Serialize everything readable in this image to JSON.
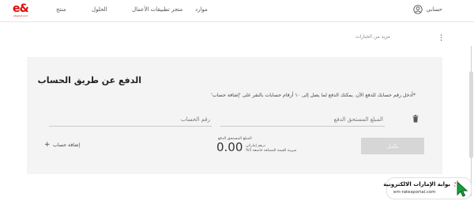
{
  "nav": {
    "logo_mark": "e&",
    "logo_sub": "etisalat and",
    "links": [
      {
        "label": "منتج"
      },
      {
        "label": "الحلول"
      },
      {
        "label": "متجر تطبيقات الأعمال"
      },
      {
        "label": "موارد"
      }
    ],
    "account_label": "حسابي"
  },
  "more_options": "مزيد من الخيارات",
  "payment": {
    "title": "الدفع عن طريق الحساب",
    "subtitle": "*أدخل رقم حسابك للدفع الآن. يمكنك الدفع لما يصل إلى ١٠ أرقام حسابات بالنقر على 'إضافة حساب'",
    "amount_placeholder": "المبلغ المستحق الدفع",
    "account_placeholder": "رقم الحساب",
    "add_account": "إضافة حساب",
    "total_label": "المبلغ المستحق الدفع",
    "total_value": "0.00",
    "currency": "درهم إماراتي",
    "vat_note": "ضريبة القيمة المضافة خاضعة 5%",
    "pay_button": "يكمل"
  },
  "watermark": {
    "title": "بوابة الإمارات الالكترونية",
    "url": "em-ratesportal.com"
  },
  "colors": {
    "brand": "#e00800",
    "card_bg": "#f4f4f4",
    "button_disabled": "#d6d6d6"
  }
}
